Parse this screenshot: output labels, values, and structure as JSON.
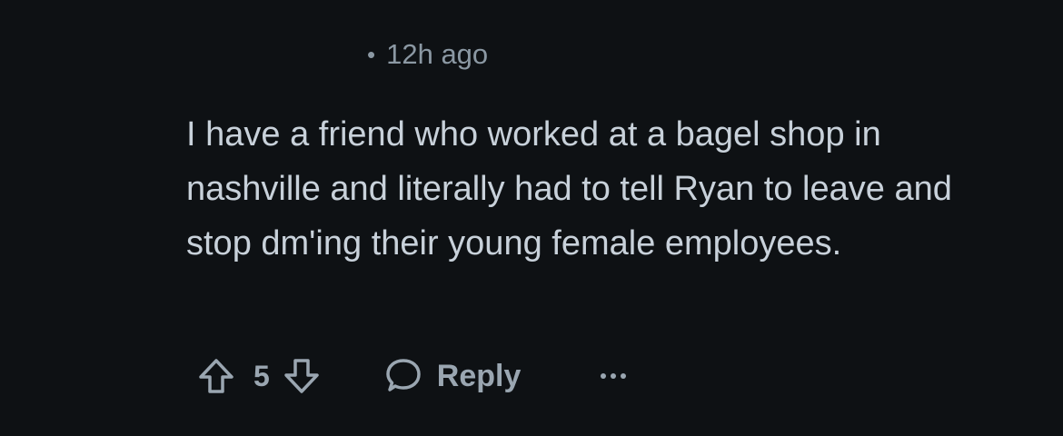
{
  "meta": {
    "separator": "•",
    "timestamp": "12h ago"
  },
  "comment": {
    "body": "I have a friend who worked at a bagel shop in nashville and literally had to tell Ryan to leave and stop dm'ing their young female employees."
  },
  "actions": {
    "score": "5",
    "reply_label": "Reply",
    "upvote_icon": "arrow-up-icon",
    "downvote_icon": "arrow-down-icon",
    "reply_icon": "speech-bubble-icon",
    "more_icon": "more-horizontal-icon"
  },
  "colors": {
    "background": "#0e1114",
    "text": "#c8d1da",
    "muted": "#8b98a3"
  }
}
